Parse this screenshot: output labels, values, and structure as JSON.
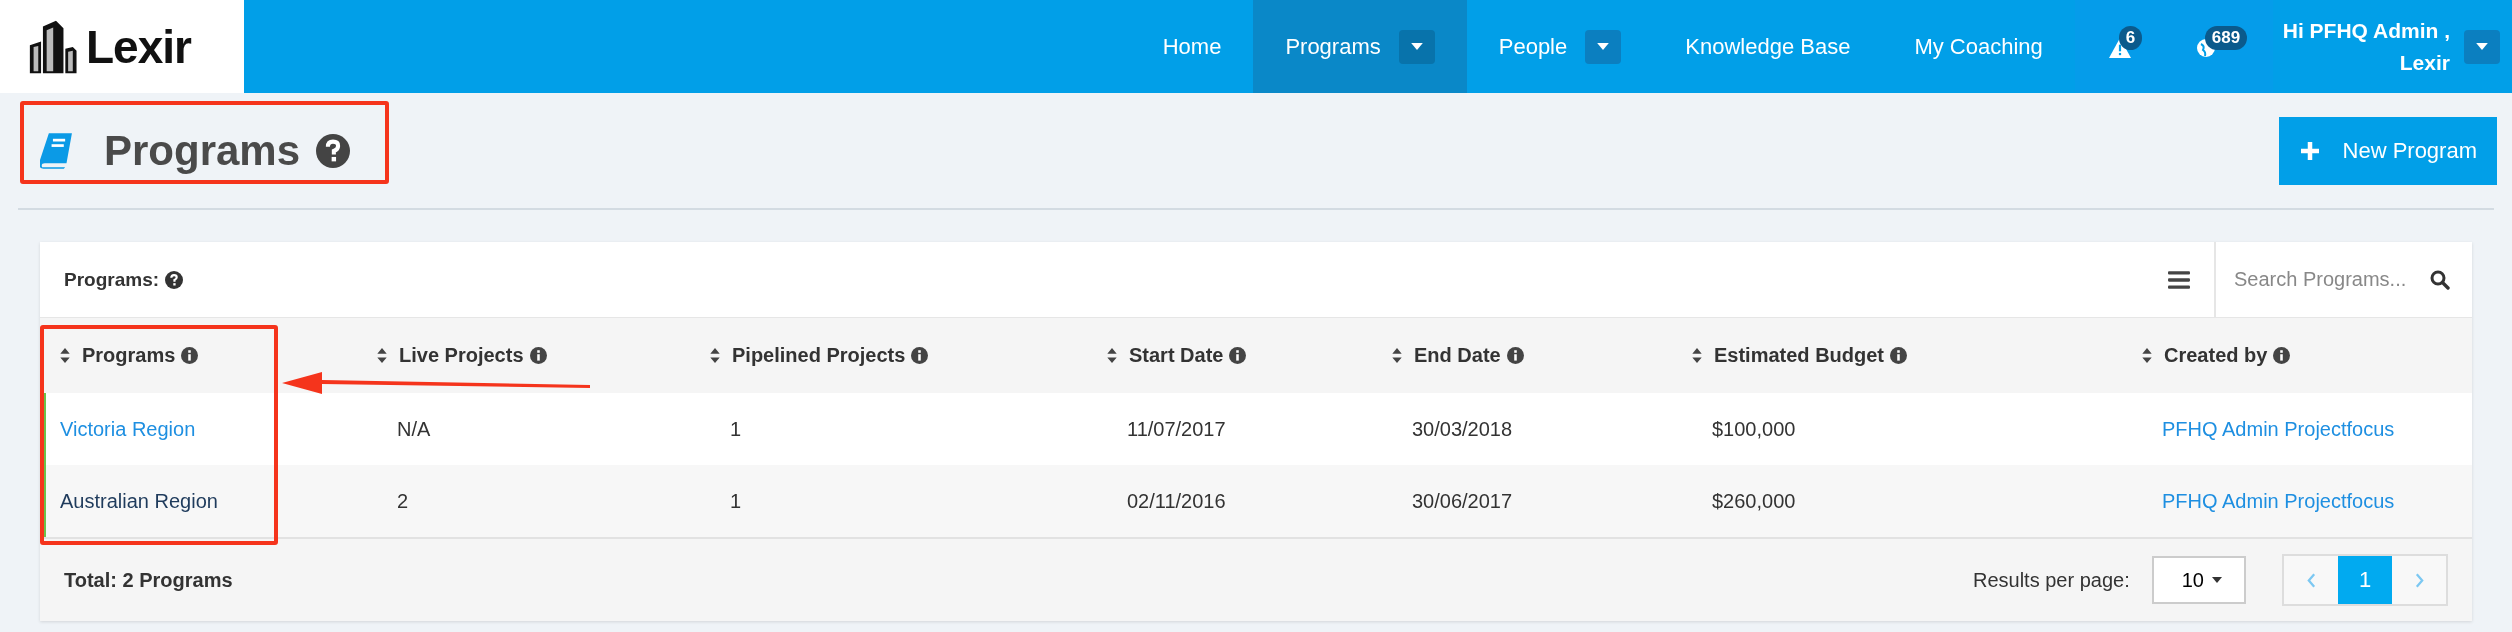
{
  "navbar": {
    "logo": "Lexir",
    "items": [
      {
        "label": "Home",
        "selected": false,
        "dropdown": false
      },
      {
        "label": "Programs",
        "selected": true,
        "dropdown": true
      },
      {
        "label": "People",
        "selected": false,
        "dropdown": true
      },
      {
        "label": "Knowledge Base",
        "selected": false,
        "dropdown": false
      },
      {
        "label": "My Coaching",
        "selected": false,
        "dropdown": false
      }
    ],
    "alerts": [
      {
        "kind": "warning",
        "count": "6"
      },
      {
        "kind": "globe",
        "count": "689"
      }
    ],
    "user": {
      "greeting": "Hi PFHQ Admin ,",
      "company": "Lexir"
    }
  },
  "page": {
    "title": "Programs",
    "new_button": "New Program"
  },
  "card": {
    "title": "Programs:",
    "search": {
      "placeholder": "Search Programs..."
    },
    "table": {
      "columns": [
        "Programs",
        "Live Projects",
        "Pipelined Projects",
        "Start Date",
        "End Date",
        "Estimated Budget",
        "Created by"
      ],
      "rows": [
        {
          "hovered": true,
          "cells": [
            "Victoria Region",
            "N/A",
            "1",
            "11/07/2017",
            "30/03/2018",
            "$100,000",
            "PFHQ Admin Projectfocus"
          ]
        },
        {
          "hovered": false,
          "cells": [
            "Australian Region",
            "2",
            "1",
            "02/11/2016",
            "30/06/2017",
            "$260,000",
            "PFHQ Admin Projectfocus"
          ]
        }
      ]
    },
    "total": "Total: 2 Programs",
    "per_page_label": "Results per page:",
    "per_page": "10",
    "pages": [
      {
        "label": "1",
        "selected": true
      }
    ]
  }
}
